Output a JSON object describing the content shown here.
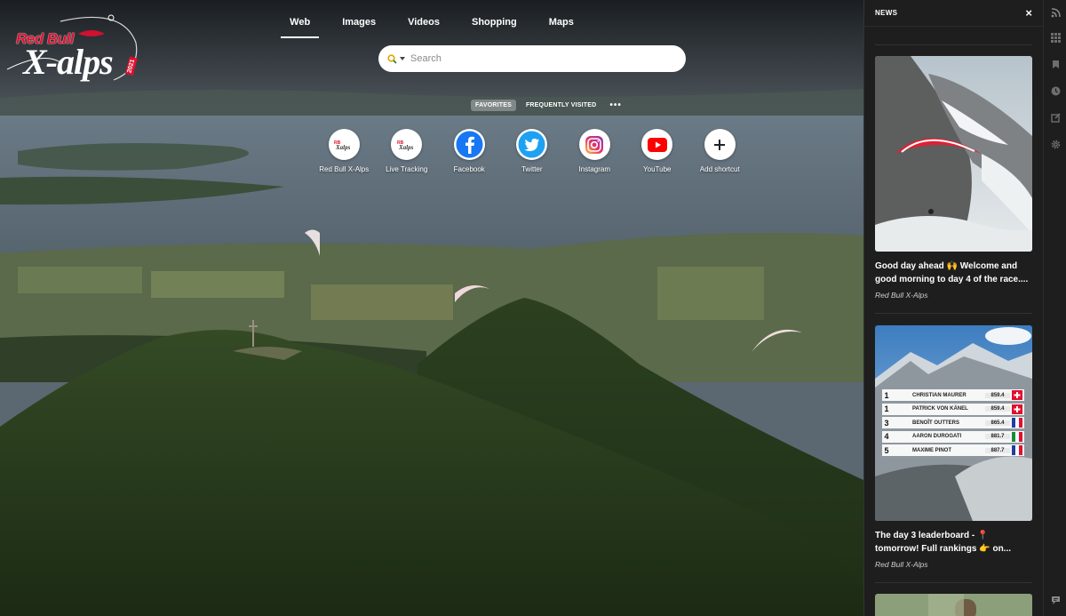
{
  "logo": {
    "brand": "Red Bull",
    "product": "X-alps",
    "year": "2021"
  },
  "nav": {
    "items": [
      "Web",
      "Images",
      "Videos",
      "Shopping",
      "Maps"
    ],
    "active": "Web"
  },
  "search": {
    "placeholder": "Search",
    "engine_icon": "magnifier-engine-icon"
  },
  "speed_dial": {
    "tabs": [
      "FAVORITES",
      "FREQUENTLY VISITED"
    ],
    "active_tab": "FAVORITES",
    "more": "•••",
    "shortcuts": [
      {
        "label": "Red Bull X-Alps",
        "icon": "xalps-logo-icon"
      },
      {
        "label": "Live Tracking",
        "icon": "xalps-logo-icon"
      },
      {
        "label": "Facebook",
        "icon": "facebook-icon",
        "color": "#1877f2"
      },
      {
        "label": "Twitter",
        "icon": "twitter-icon",
        "color": "#1da1f2"
      },
      {
        "label": "Instagram",
        "icon": "instagram-icon",
        "color": "#d6249f"
      },
      {
        "label": "YouTube",
        "icon": "youtube-icon",
        "color": "#ff0000"
      },
      {
        "label": "Add shortcut",
        "icon": "plus-icon"
      }
    ]
  },
  "news": {
    "title": "NEWS",
    "close": "×",
    "items": [
      {
        "text": "Good day ahead 🙌 Welcome and good morning to day 4 of the race....",
        "source": "Red Bull X-Alps"
      },
      {
        "text": "The day 3 leaderboard - 📍 tomorrow! Full rankings 👉 on...",
        "source": "Red Bull X-Alps"
      }
    ],
    "leaderboard": [
      {
        "rank": "1",
        "name": "CHRISTIAN MAURER",
        "time": "859.4",
        "country": "SUI"
      },
      {
        "rank": "1",
        "name": "PATRICK VON KÄNEL",
        "time": "859.4",
        "country": "SUI"
      },
      {
        "rank": "3",
        "name": "BENOÎT OUTTERS",
        "time": "865.4",
        "country": "FRA"
      },
      {
        "rank": "4",
        "name": "AARON DUROGATI",
        "time": "881.7",
        "country": "ITA"
      },
      {
        "rank": "5",
        "name": "MAXIME PINOT",
        "time": "887.7",
        "country": "FRA"
      }
    ]
  },
  "rail": {
    "icons": [
      "rss-icon",
      "apps-grid-icon",
      "bookmarks-icon",
      "history-icon",
      "notes-icon",
      "settings-gear-icon",
      "feedback-icon"
    ]
  }
}
